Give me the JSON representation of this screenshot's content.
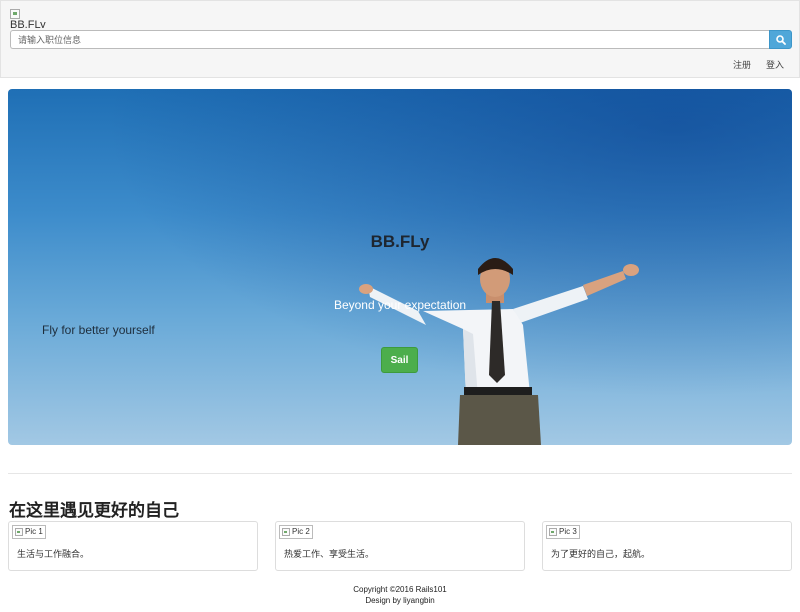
{
  "header": {
    "logo_alt": "BB.FLy",
    "search": {
      "placeholder": "请输入职位信息",
      "value": ""
    },
    "search_icon": "search-icon",
    "nav": {
      "register": "注册",
      "login": "登入"
    }
  },
  "hero": {
    "title": "BB.FLy",
    "subtitle": "Beyond your expectation",
    "side_text": "Fly for better yourself",
    "button_label": "Sail",
    "colors": {
      "sky_top": "#1f6fb5",
      "sky_bottom": "#a2c8e4",
      "button": "#4cae4c"
    }
  },
  "section": {
    "title": "在这里遇见更好的自己",
    "cards": [
      {
        "image_alt": "Pic 1",
        "caption": "生活与工作融合。"
      },
      {
        "image_alt": "Pic 2",
        "caption": "热爱工作、享受生活。"
      },
      {
        "image_alt": "Pic 3",
        "caption": "为了更好的自己，起航。"
      }
    ]
  },
  "footer": {
    "copyright": "Copyright ©2016 Rails101",
    "design": "Design by liyangbin"
  }
}
